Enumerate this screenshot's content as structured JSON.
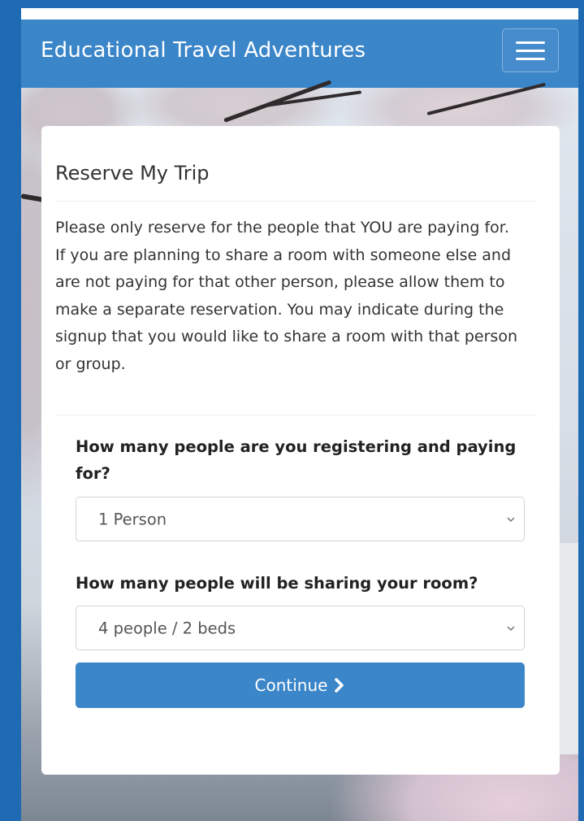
{
  "navbar": {
    "brand": "Educational Travel Adventures",
    "menu_icon": "hamburger-menu-icon"
  },
  "card": {
    "title": "Reserve My Trip",
    "intro": "Please only reserve for the people that YOU are paying for. If you are planning to share a room with someone else and are not paying for that other person, please allow them to make a separate reservation. You may indicate during the signup that you would like to share a room with that person or group."
  },
  "form": {
    "people_count": {
      "label": "How many people are you registering and paying for?",
      "selected": "1 Person"
    },
    "room_sharing": {
      "label": "How many people will be sharing your room?",
      "selected": "4 people / 2 beds"
    },
    "continue_label": "Continue",
    "continue_icon": "chevron-right-icon",
    "select_icon": "chevron-down-icon"
  },
  "colors": {
    "primary": "#3b85c9",
    "outer_background": "#1e6bb3",
    "card_background": "#ffffff",
    "text": "#333333"
  }
}
